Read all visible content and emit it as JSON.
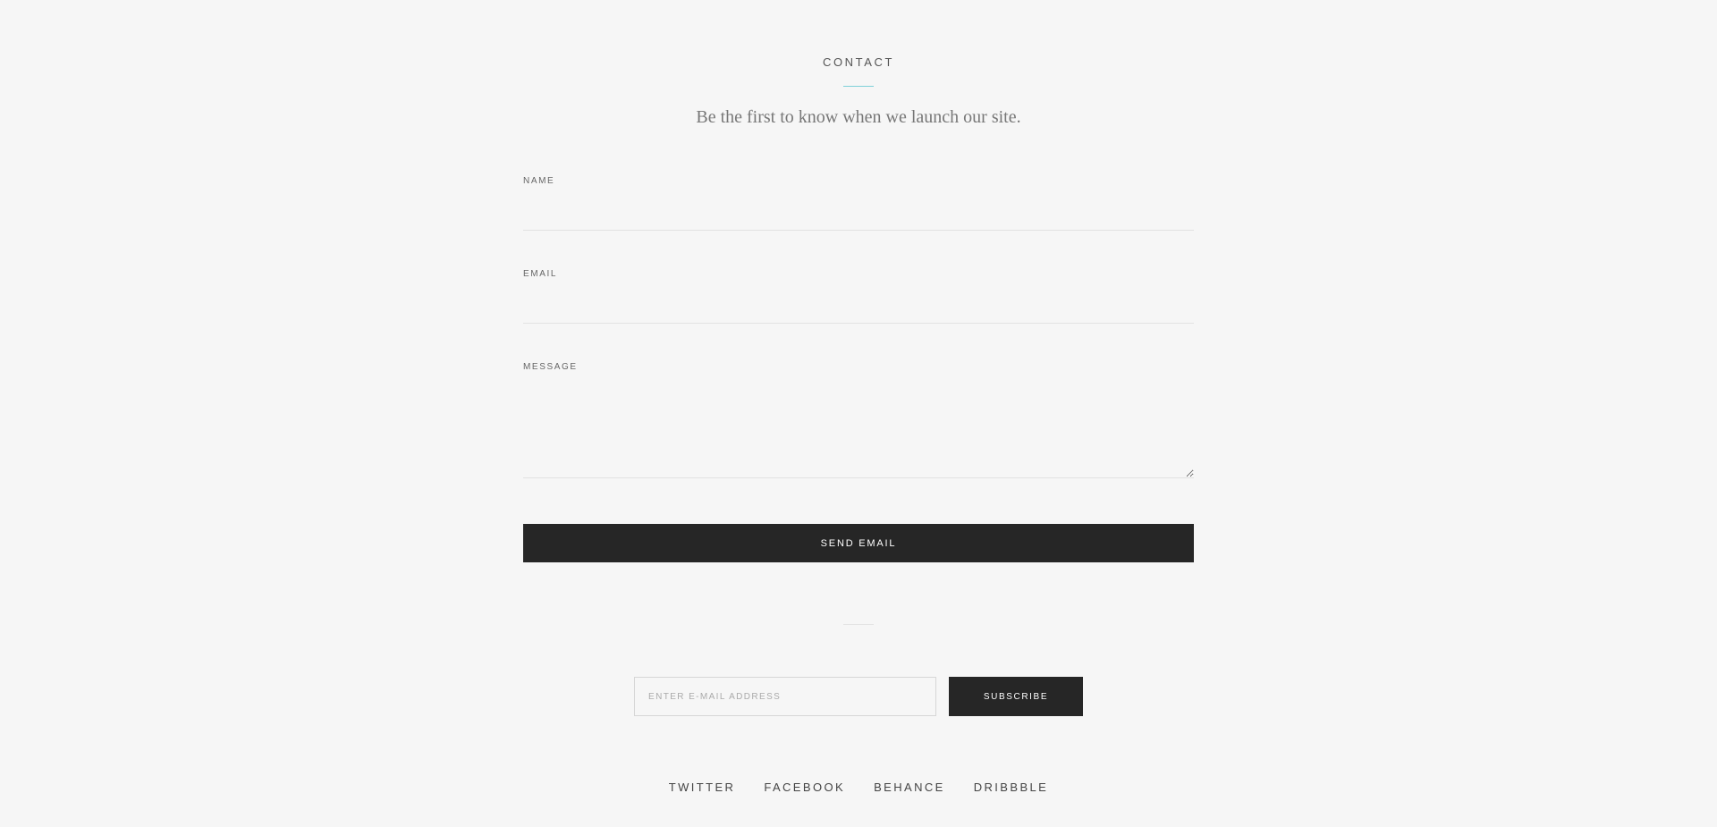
{
  "section": {
    "title": "CONTACT",
    "tagline": "Be the first to know when we launch our site."
  },
  "form": {
    "name_label": "NAME",
    "name_value": "",
    "email_label": "EMAIL",
    "email_value": "",
    "message_label": "MESSAGE",
    "message_value": "",
    "send_label": "SEND EMAIL"
  },
  "subscribe": {
    "placeholder": "ENTER E-MAIL ADDRESS",
    "value": "",
    "button_label": "SUBSCRIBE"
  },
  "social": {
    "links": [
      {
        "label": "TWITTER"
      },
      {
        "label": "FACEBOOK"
      },
      {
        "label": "BEHANCE"
      },
      {
        "label": "DRIBBBLE"
      }
    ]
  },
  "colors": {
    "background": "#f6f6f6",
    "button": "#262626",
    "accent": "#7fd0d8",
    "line": "#e2e2e2"
  }
}
